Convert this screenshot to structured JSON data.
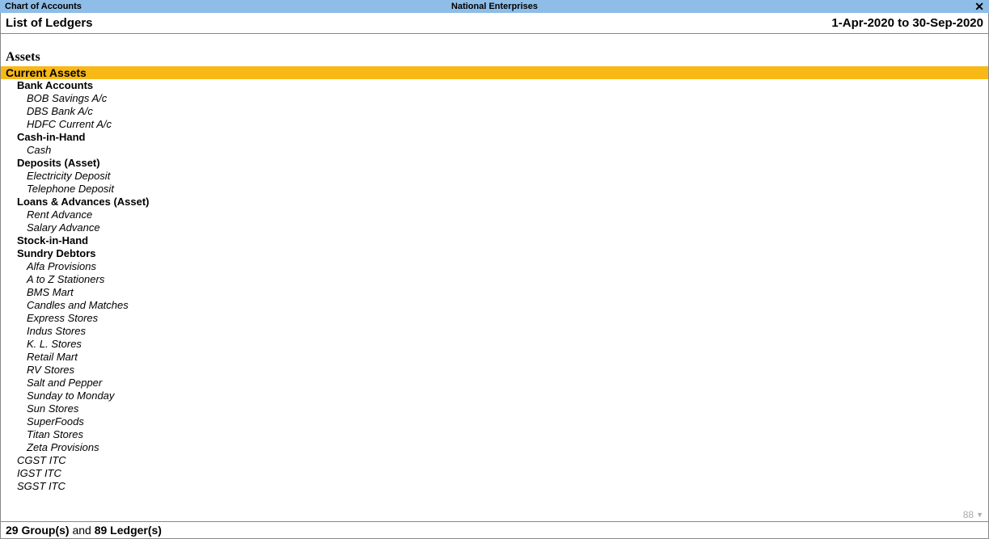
{
  "titlebar": {
    "left": "Chart of Accounts",
    "center": "National Enterprises",
    "close": "✕"
  },
  "header": {
    "title": "List of Ledgers",
    "period": "1-Apr-2020 to 30-Sep-2020"
  },
  "section": {
    "main": "Assets",
    "highlighted": "Current Assets"
  },
  "groups": {
    "bank": {
      "label": "Bank Accounts",
      "items": [
        "BOB Savings A/c",
        "DBS Bank A/c",
        "HDFC Current A/c"
      ]
    },
    "cash": {
      "label": "Cash-in-Hand",
      "items": [
        "Cash"
      ]
    },
    "deposits": {
      "label": "Deposits (Asset)",
      "items": [
        "Electricity Deposit",
        "Telephone Deposit"
      ]
    },
    "loans": {
      "label": "Loans & Advances (Asset)",
      "items": [
        "Rent Advance",
        "Salary Advance"
      ]
    },
    "stock": {
      "label": "Stock-in-Hand",
      "items": []
    },
    "debtors": {
      "label": "Sundry Debtors",
      "items": [
        "Alfa Provisions",
        "A to Z Stationers",
        "BMS Mart",
        "Candles and Matches",
        "Express Stores",
        "Indus Stores",
        "K. L. Stores",
        "Retail Mart",
        "RV Stores",
        "Salt and Pepper",
        "Sunday to Monday",
        "Sun Stores",
        "SuperFoods",
        "Titan Stores",
        "Zeta Provisions"
      ]
    },
    "direct_ledgers": [
      "CGST ITC",
      "IGST ITC",
      "SGST ITC"
    ]
  },
  "pager": {
    "remaining": "88"
  },
  "footer": {
    "groups_count": "29",
    "groups_label": " Group(s) ",
    "and": " and  ",
    "ledgers_count": "89",
    "ledgers_label": " Ledger(s)"
  }
}
